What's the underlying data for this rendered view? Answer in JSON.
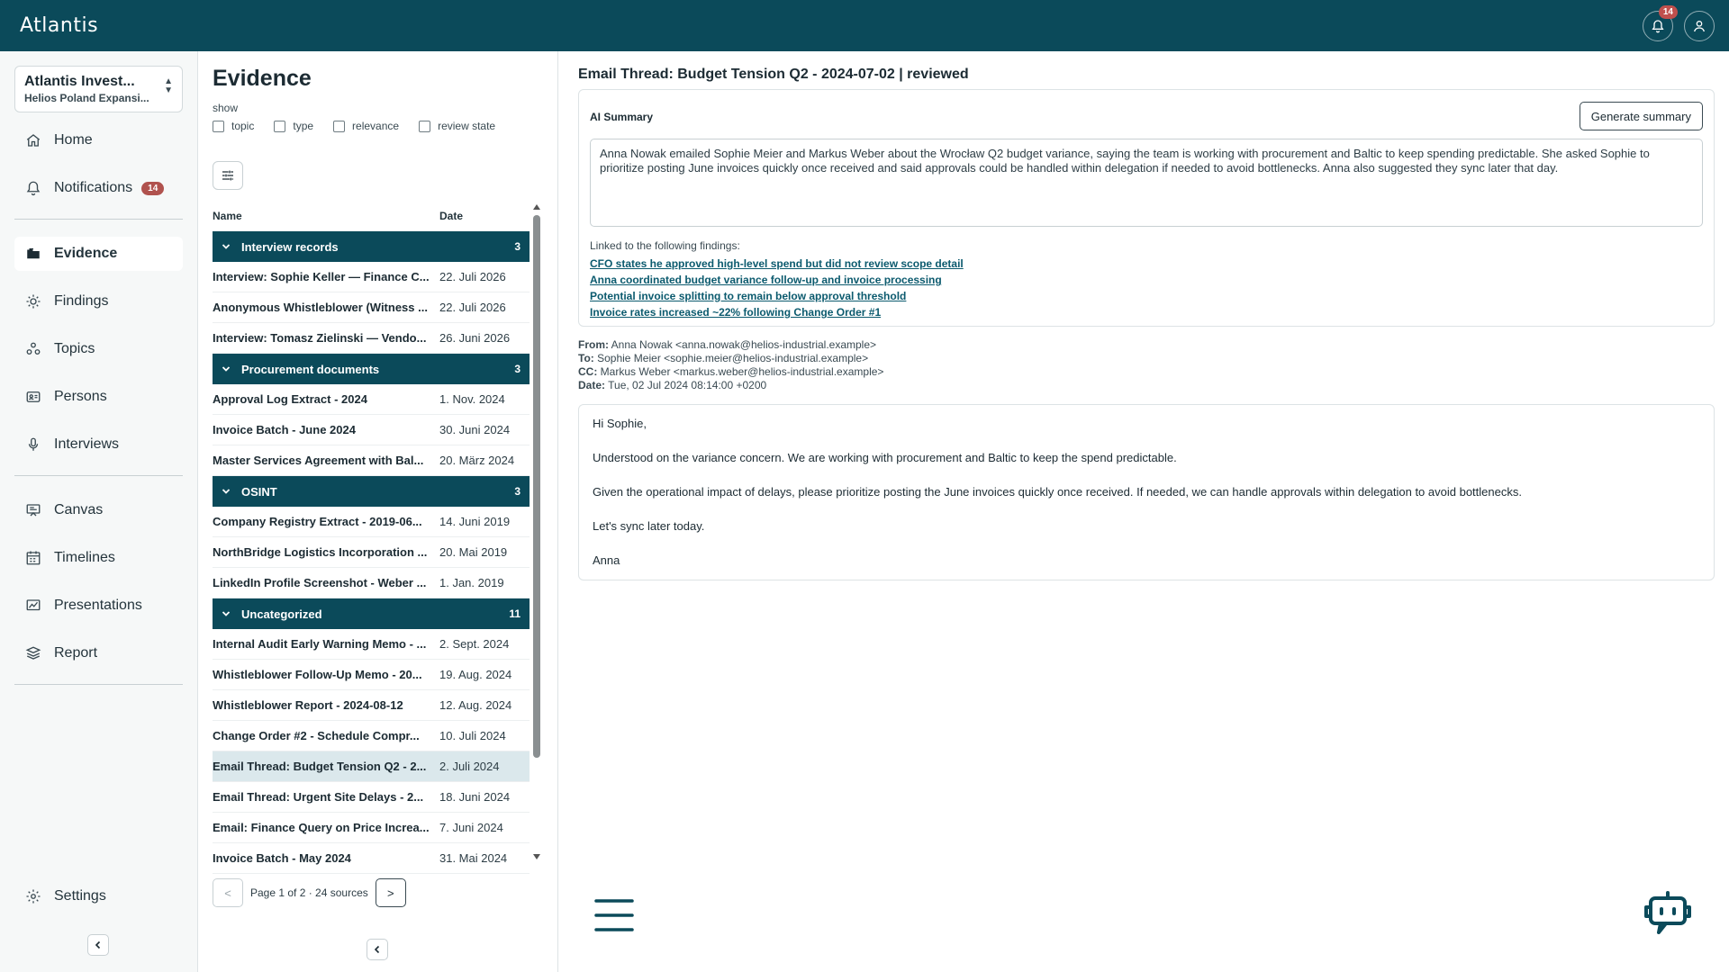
{
  "app": {
    "logo": "Atlantis",
    "notification_count": "14"
  },
  "workspace": {
    "name": "Atlantis Invest...",
    "subtitle": "Helios Poland Expansi..."
  },
  "nav": {
    "home": "Home",
    "notifications": "Notifications",
    "notifications_badge": "14",
    "evidence": "Evidence",
    "findings": "Findings",
    "topics": "Topics",
    "persons": "Persons",
    "interviews": "Interviews",
    "canvas": "Canvas",
    "timelines": "Timelines",
    "presentations": "Presentations",
    "report": "Report",
    "settings": "Settings"
  },
  "evidence": {
    "title": "Evidence",
    "show_label": "show",
    "filters": [
      "topic",
      "type",
      "relevance",
      "review state"
    ],
    "columns": {
      "name": "Name",
      "date": "Date"
    },
    "groups": [
      {
        "label": "Interview records",
        "count": "3",
        "rows": [
          {
            "name": "Interview: Sophie Keller — Finance C...",
            "date": "22. Juli 2026"
          },
          {
            "name": "Anonymous Whistleblower (Witness ...",
            "date": "22. Juli 2026"
          },
          {
            "name": "Interview: Tomasz Zielinski — Vendo...",
            "date": "26. Juni 2026"
          }
        ]
      },
      {
        "label": "Procurement documents",
        "count": "3",
        "rows": [
          {
            "name": "Approval Log Extract - 2024",
            "date": "1. Nov. 2024"
          },
          {
            "name": "Invoice Batch - June 2024",
            "date": "30. Juni 2024"
          },
          {
            "name": "Master Services Agreement with Bal...",
            "date": "20. März 2024"
          }
        ]
      },
      {
        "label": "OSINT",
        "count": "3",
        "rows": [
          {
            "name": "Company Registry Extract - 2019-06...",
            "date": "14. Juni 2019"
          },
          {
            "name": "NorthBridge Logistics Incorporation ...",
            "date": "20. Mai 2019"
          },
          {
            "name": "LinkedIn Profile Screenshot - Weber ...",
            "date": "1. Jan. 2019"
          }
        ]
      },
      {
        "label": "Uncategorized",
        "count": "11",
        "rows": [
          {
            "name": "Internal Audit Early Warning Memo - ...",
            "date": "2. Sept. 2024"
          },
          {
            "name": "Whistleblower Follow-Up Memo - 20...",
            "date": "19. Aug. 2024"
          },
          {
            "name": "Whistleblower Report - 2024-08-12",
            "date": "12. Aug. 2024"
          },
          {
            "name": "Change Order #2 - Schedule Compr...",
            "date": "10. Juli 2024"
          },
          {
            "name": "Email Thread: Budget Tension Q2 - 2...",
            "date": "2. Juli 2024",
            "selected": true
          },
          {
            "name": "Email Thread: Urgent Site Delays - 2...",
            "date": "18. Juni 2024"
          },
          {
            "name": "Email: Finance Query on Price Increa...",
            "date": "7. Juni 2024"
          },
          {
            "name": "Invoice Batch - May 2024",
            "date": "31. Mai 2024"
          }
        ]
      }
    ],
    "pager": {
      "prev": "<",
      "text": "Page 1 of 2 · 24 sources",
      "next": ">"
    }
  },
  "detail": {
    "title": "Email Thread: Budget Tension Q2 - 2024-07-02 | reviewed",
    "ai_summary_label": "AI Summary",
    "generate_button": "Generate summary",
    "summary": "Anna Nowak emailed Sophie Meier and Markus Weber about the Wrocław Q2 budget variance, saying the team is working with procurement and Baltic to keep spending predictable. She asked Sophie to prioritize posting June invoices quickly once received and said approvals could be handled within delegation if needed to avoid bottlenecks. Anna also suggested they sync later that day.",
    "linked_label": "Linked to the following findings:",
    "linked_findings": [
      "CFO states he approved high-level spend but did not review scope detail",
      "Anna coordinated budget variance follow-up and invoice processing",
      "Potential invoice splitting to remain below approval threshold",
      "Invoice rates increased ~22% following Change Order #1"
    ],
    "headers": {
      "from_label": "From:",
      "from": "Anna Nowak <anna.nowak@helios-industrial.example>",
      "to_label": "To:",
      "to": "Sophie Meier <sophie.meier@helios-industrial.example>",
      "cc_label": "CC:",
      "cc": "Markus Weber <markus.weber@helios-industrial.example>",
      "date_label": "Date:",
      "date": "Tue, 02 Jul 2024 08:14:00 +0200"
    },
    "body": [
      "Hi Sophie,",
      "Understood on the variance concern. We are working with procurement and Baltic to keep the spend predictable.",
      "Given the operational impact of delays, please prioritize posting the June invoices quickly once received. If needed, we can handle approvals within delegation to avoid bottlenecks.",
      "Let's sync later today.",
      "Anna"
    ]
  },
  "colors": {
    "brand": "#0b4a5a",
    "badge": "#b0524e",
    "selected_row": "#dbe8ec",
    "link": "#0b5a6e"
  },
  "icons": [
    "bell-icon",
    "user-icon",
    "home-icon",
    "evidence-icon",
    "findings-icon",
    "topics-icon",
    "persons-icon",
    "interviews-icon",
    "canvas-icon",
    "timelines-icon",
    "presentations-icon",
    "report-icon",
    "settings-icon",
    "tune-icon",
    "chevron-down-icon",
    "chevron-left-icon",
    "menu-icon",
    "chatbot-icon"
  ]
}
